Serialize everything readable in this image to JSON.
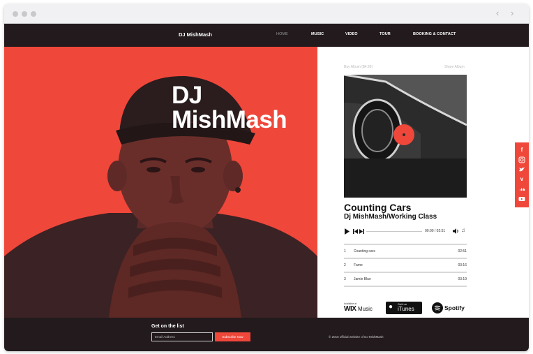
{
  "browser": {
    "back_icon": "chevron-left-icon",
    "forward_icon": "chevron-right-icon"
  },
  "header": {
    "brand": "DJ MishMash",
    "nav": [
      "HOME",
      "MUSIC",
      "VIDEO",
      "TOUR",
      "BOOKING & CONTACT"
    ],
    "active": "HOME"
  },
  "hero": {
    "title_line1": "DJ",
    "title_line2": "MishMash"
  },
  "player": {
    "buy_label": "Buy Album ($4.99)",
    "share_label": "Share Album",
    "track_title": "Counting Cars",
    "artist": "Dj MishMash/Working Class",
    "time": "00:00 / 02:51",
    "progress_fraction": 0,
    "tracks": [
      {
        "num": "1",
        "title": "Counting cars",
        "duration": "02:51"
      },
      {
        "num": "2",
        "title": "Fame",
        "duration": "03:16"
      },
      {
        "num": "3",
        "title": "Jamie Blue",
        "duration": "03:19"
      }
    ],
    "logos": {
      "wix_small": "Available at",
      "wix_main": "WIX",
      "wix_music": "Music",
      "itunes_small": "Get it on",
      "itunes_main": "iTunes",
      "spotify": "Spotify"
    }
  },
  "social": [
    "facebook-icon",
    "instagram-icon",
    "twitter-icon",
    "vimeo-icon",
    "soundcloud-icon",
    "youtube-icon"
  ],
  "footer": {
    "list_title": "Get on the list",
    "email_placeholder": "Email Address",
    "subscribe_label": "Subscribe Now",
    "copyright": "© 2016 official website of DJ MishMash"
  },
  "colors": {
    "accent": "#f0473b",
    "dark": "#221a1c",
    "white": "#ffffff"
  }
}
